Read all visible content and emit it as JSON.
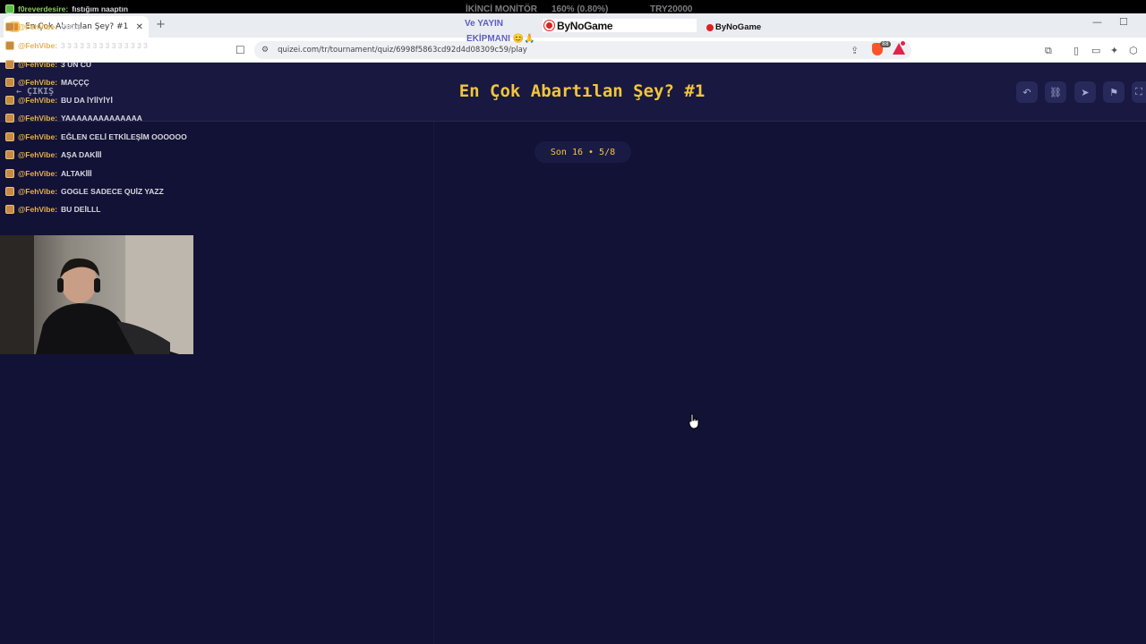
{
  "browser": {
    "tab_title": "En Çok Abartılan Şey? #1 - Tier...",
    "tab_close": "✕",
    "new_tab": "+",
    "url": "quizei.com/tr/tournament/quiz/6998f5863cd92d4d08309c59/play",
    "brave_badge": "88",
    "minimize": "—",
    "maximize": "☐"
  },
  "overlay": {
    "monitor": "İKİNCİ MONİTÖR",
    "percent": "160% (0.80%)",
    "currency": "TRY20000",
    "yayin": "Ve YAYIN",
    "ekipman": "EKİPMANI 😊🙏",
    "brand": "ByNoGame",
    "brand_small": "ByNoGame"
  },
  "header": {
    "exit_label": "ÇIKIŞ",
    "exit_arrow": "←",
    "title": "En Çok Abartılan Şey? #1"
  },
  "progress": {
    "label": "Son 16 • 5/8"
  },
  "chat": [
    {
      "user": "f0reverdesire:",
      "message": "fıstığım naaptın",
      "color": "green"
    },
    {
      "user": "@FehVibe:",
      "message": "ÇIKIŞ",
      "color": "orange"
    },
    {
      "user": "@FehVibe:",
      "message": "3 3 3 3 3 3 3 3 3 3 3 3 3 3",
      "color": "orange"
    },
    {
      "user": "@FehVibe:",
      "message": "3 ÜN CÜ",
      "color": "orange"
    },
    {
      "user": "@FehVibe:",
      "message": "MAÇÇÇ",
      "color": "orange"
    },
    {
      "user": "@FehVibe:",
      "message": "BU DA İYİİYİYİ",
      "color": "orange"
    },
    {
      "user": "@FehVibe:",
      "message": "YAAAAAAAAAAAAAA",
      "color": "orange"
    },
    {
      "user": "@FehVibe:",
      "message": "EĞLEN CELİ ETKİLEŞİM OOOOOO",
      "color": "orange"
    },
    {
      "user": "@FehVibe:",
      "message": "AŞA DAKİİİ",
      "color": "orange"
    },
    {
      "user": "@FehVibe:",
      "message": "ALTAKİİİ",
      "color": "orange"
    },
    {
      "user": "@FehVibe:",
      "message": "GOGLE SADECE QUİZ YAZZ",
      "color": "orange"
    },
    {
      "user": "@FehVibe:",
      "message": "BU DEİLLL",
      "color": "orange"
    }
  ]
}
